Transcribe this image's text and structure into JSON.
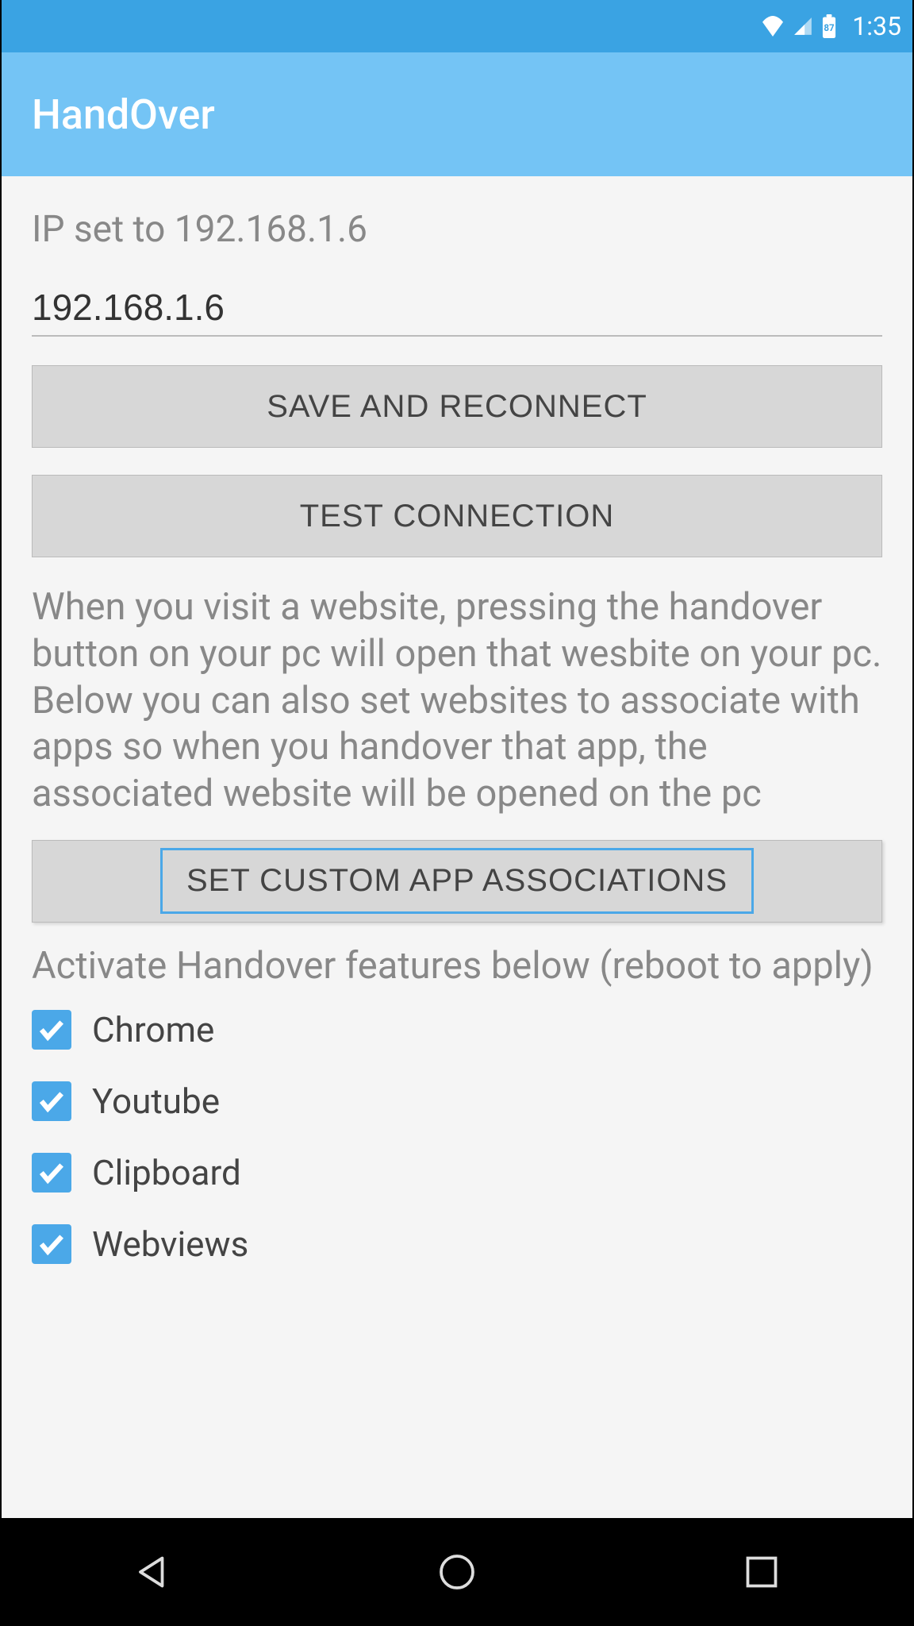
{
  "statusBar": {
    "batteryLevel": "87",
    "time": "1:35"
  },
  "appBar": {
    "title": "HandOver"
  },
  "content": {
    "ipStatus": "IP set to 192.168.1.6",
    "ipValue": "192.168.1.6",
    "saveButton": "SAVE AND RECONNECT",
    "testButton": "TEST CONNECTION",
    "description": "When you visit a website, pressing the handover button on your pc will open that wesbite on your pc. Below you can also set websites to associate with apps so when you handover that app, the associated website will be opened on the pc",
    "customButton": "SET CUSTOM APP ASSOCIATIONS",
    "featuresTitle": "Activate Handover features below (reboot to apply)",
    "features": [
      {
        "label": "Chrome",
        "checked": true
      },
      {
        "label": "Youtube",
        "checked": true
      },
      {
        "label": "Clipboard",
        "checked": true
      },
      {
        "label": "Webviews",
        "checked": true
      }
    ]
  }
}
